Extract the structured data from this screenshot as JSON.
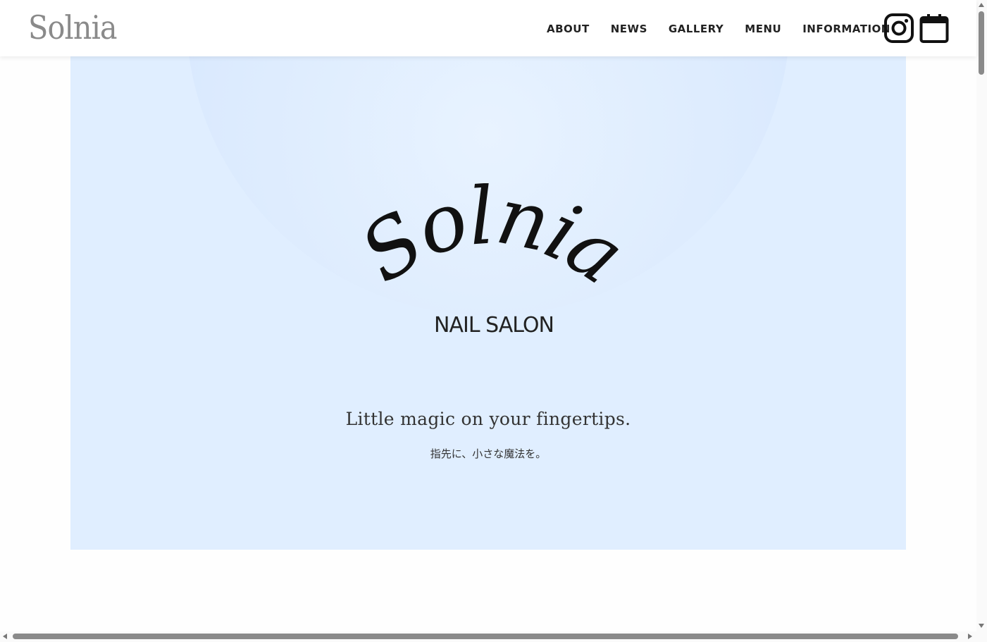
{
  "header": {
    "brand": "Solnia",
    "nav": [
      {
        "label": "ABOUT"
      },
      {
        "label": "NEWS"
      },
      {
        "label": "GALLERY"
      },
      {
        "label": "MENU"
      },
      {
        "label": "INFORMATION"
      }
    ],
    "icons": [
      "instagram-icon",
      "calendar-icon"
    ]
  },
  "hero": {
    "logo_text": "Solnia",
    "logo_subtitle": "NAIL SALON",
    "tagline": "Little magic on your fingertips.",
    "subtagline": "指先に、小さな魔法を。"
  },
  "colors": {
    "hero_background": "#e0eeff",
    "bubble": "#d2e5fd",
    "text": "#222222",
    "brand_gray": "#8a8a8a"
  }
}
